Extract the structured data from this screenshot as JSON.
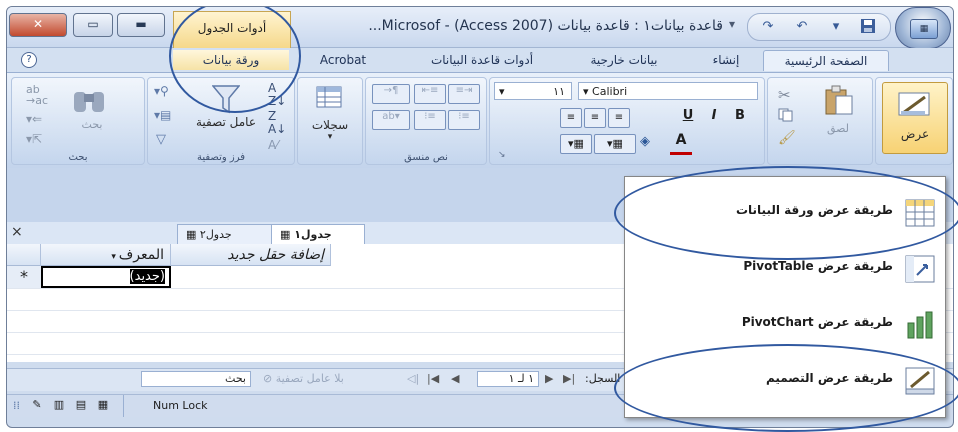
{
  "window": {
    "title": "قاعدة بيانات١ : قاعدة بيانات (Access 2007) - Microsof...",
    "contextual_tab_title": "أدوات الجدول",
    "qat_dropdown": "▾"
  },
  "tabs": [
    {
      "label": "الصفحة الرئيسية"
    },
    {
      "label": "إنشاء"
    },
    {
      "label": "بيانات خارجية"
    },
    {
      "label": "أدوات قاعدة البيانات"
    },
    {
      "label": "Acrobat"
    },
    {
      "label": "ورقة بيانات"
    }
  ],
  "ribbon": {
    "views": {
      "button": "عرض"
    },
    "clipboard": {
      "paste": "لصق"
    },
    "font": {
      "name": "Calibri",
      "size": "١١",
      "bold": "B",
      "italic": "I",
      "underline": "U"
    },
    "rich_text": {
      "label": "نص منسق"
    },
    "records": {
      "button": "سجلات"
    },
    "sort_filter": {
      "filter": "عامل تصفية",
      "label": "فرز وتصفية"
    },
    "find": {
      "button": "بحث",
      "label": "بحث"
    }
  },
  "doc_tabs": [
    {
      "label": "جدول١"
    },
    {
      "label": "جدول٢"
    }
  ],
  "datasheet": {
    "columns": [
      "المعرف",
      "إضافة حقل جديد"
    ],
    "new_row_marker": "*",
    "new_row_value": "(جديد)"
  },
  "record_nav": {
    "label": "السجل:",
    "position": "١ لـ ١",
    "filter_status": "بلا عامل تصفية",
    "search": "بحث"
  },
  "status_bar": {
    "num_lock": "Num Lock"
  },
  "views_menu": {
    "items": [
      {
        "label": "طريقة عرض ورقة البيانات",
        "icon": "datasheet-grid-icon"
      },
      {
        "label": "طريقة عرض PivotTable",
        "icon": "pivot-table-icon"
      },
      {
        "label": "طريقة عرض PivotChart",
        "icon": "pivot-chart-icon"
      },
      {
        "label": "طريقة عرض التصميم",
        "icon": "design-ruler-icon"
      }
    ]
  },
  "colors": {
    "accent_blue": "#3159a0",
    "contextual_yellow": "#f5d88a",
    "ribbon_bg": "#c3d4ec"
  }
}
